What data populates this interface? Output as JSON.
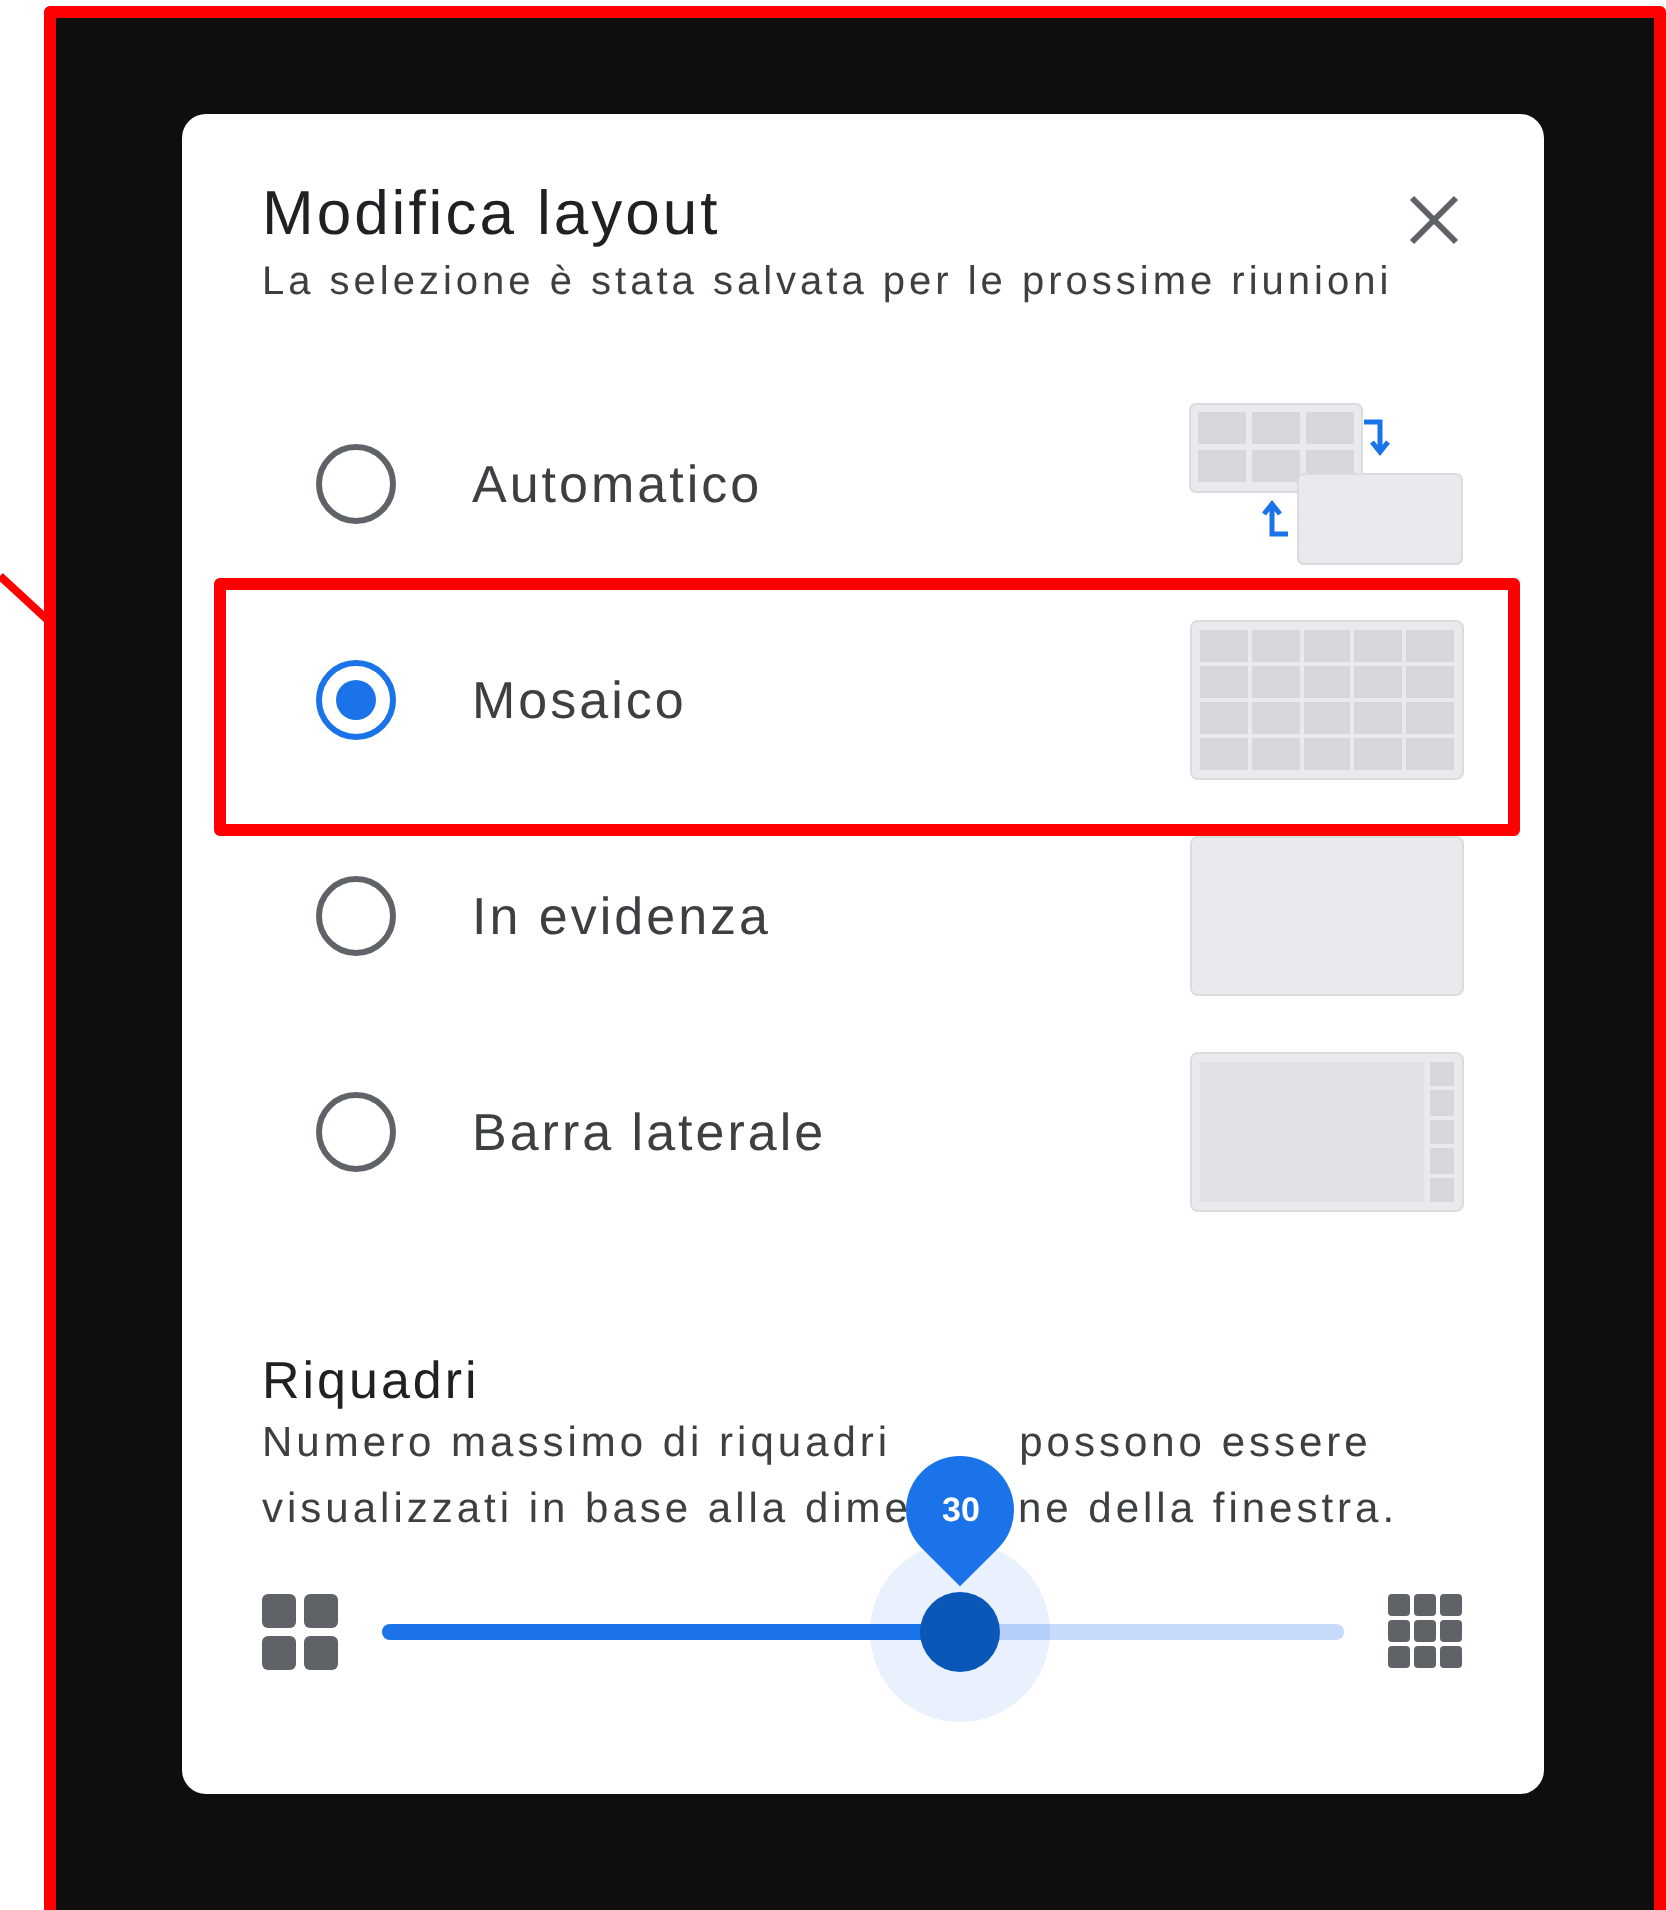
{
  "dialog": {
    "title": "Modifica layout",
    "subtitle": "La selezione è stata salvata per le prossime riunioni",
    "options": [
      {
        "label": "Automatico",
        "kind": "auto",
        "selected": false,
        "highlighted": false
      },
      {
        "label": "Mosaico",
        "kind": "tiles",
        "selected": true,
        "highlighted": true
      },
      {
        "label": "In evidenza",
        "kind": "spotlight",
        "selected": false,
        "highlighted": false
      },
      {
        "label": "Barra laterale",
        "kind": "sidebar",
        "selected": false,
        "highlighted": false
      }
    ],
    "tiles": {
      "title": "Riquadri",
      "description_lines": [
        [
          "Numero massimo di riquadri",
          "possono essere"
        ],
        [
          "visualizzati in base alla dime",
          "ne della finestra."
        ]
      ],
      "slider": {
        "level": 0.6,
        "value": "30"
      }
    }
  }
}
